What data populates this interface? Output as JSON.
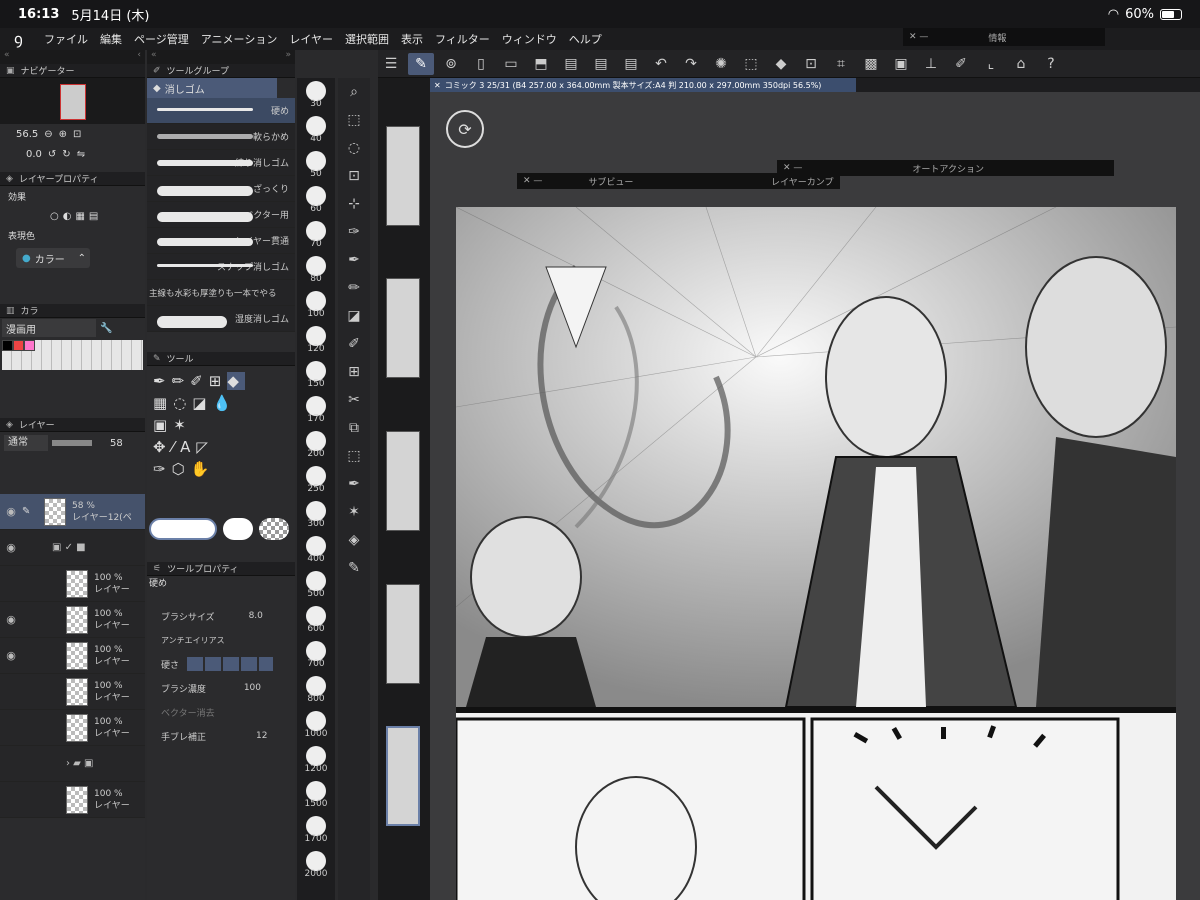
{
  "status": {
    "time": "16:13",
    "date": "5月14日 (木)",
    "battery": "60%"
  },
  "menu": [
    "ファイル",
    "編集",
    "ページ管理",
    "アニメーション",
    "レイヤー",
    "選択範囲",
    "表示",
    "フィルター",
    "ウィンドウ",
    "ヘルプ"
  ],
  "info_window": {
    "title": "情報"
  },
  "navigator": {
    "title": "ナビゲーター",
    "zoom": "56.5",
    "rotation": "0.0"
  },
  "layer_property": {
    "title": "レイヤープロパティ",
    "effect_label": "効果",
    "color_label": "表現色",
    "color_value": "カラー"
  },
  "color_set": {
    "tab": "カラ",
    "set_name": "漫画用"
  },
  "layer_panel": {
    "title": "レイヤー",
    "blend": "通常",
    "opacity": "58",
    "layers": [
      {
        "opacity": "58 %",
        "mode": "通常",
        "name": "レイヤー12(ペ"
      },
      {
        "opacity": "",
        "mode": "",
        "name": ""
      },
      {
        "opacity": "100 %",
        "name": "レイヤー"
      },
      {
        "opacity": "100 %",
        "name": "レイヤー"
      },
      {
        "opacity": "100 %",
        "name": "レイヤー"
      },
      {
        "opacity": "100 %",
        "name": "レイヤー"
      },
      {
        "opacity": "100 %",
        "name": "レイヤー"
      },
      {
        "opacity": "",
        "name": ""
      },
      {
        "opacity": "100 %",
        "name": "レイヤー"
      },
      {
        "opacity": "100 %",
        "name": "レイヤー"
      }
    ]
  },
  "tool_group": {
    "title": "ツールグループ",
    "active": "消しゴム"
  },
  "brushes": [
    "硬め",
    "軟らかめ",
    "練り消しゴム",
    "ざっくり",
    "ベクター用",
    "レイヤー貫通",
    "スナップ消しゴム",
    "主線も水彩も厚塗りも一本でやる",
    "湿度消しゴム"
  ],
  "tools_panel": {
    "title": "ツール"
  },
  "tool_property": {
    "title": "ツールプロパティ",
    "preset": "硬め",
    "brush_size_label": "ブラシサイズ",
    "brush_size": "8.0",
    "antialias_label": "アンチエイリアス",
    "hardness_label": "硬さ",
    "density_label": "ブラシ濃度",
    "density": "100",
    "vector_erase_label": "ベクター消去",
    "stabilization_label": "手ブレ補正",
    "stabilization": "12"
  },
  "brush_sizes": [
    "30",
    "40",
    "50",
    "60",
    "70",
    "80",
    "100",
    "120",
    "150",
    "170",
    "200",
    "250",
    "300",
    "400",
    "500",
    "600",
    "700",
    "800",
    "1000",
    "1200",
    "1500",
    "1700",
    "2000"
  ],
  "document_tab": "コミック 3 25/31 (B4 257.00 x 364.00mm 製本サイズ:A4 判 210.00 x 297.00mm 350dpi 56.5%)",
  "float_windows": {
    "subview": "サブビュー",
    "layer_comp": "レイヤーカンプ",
    "auto_action": "オートアクション"
  },
  "colors": {
    "accent": "#4b5a78",
    "panel": "#2b2b2d",
    "header": "#1f1f21"
  }
}
